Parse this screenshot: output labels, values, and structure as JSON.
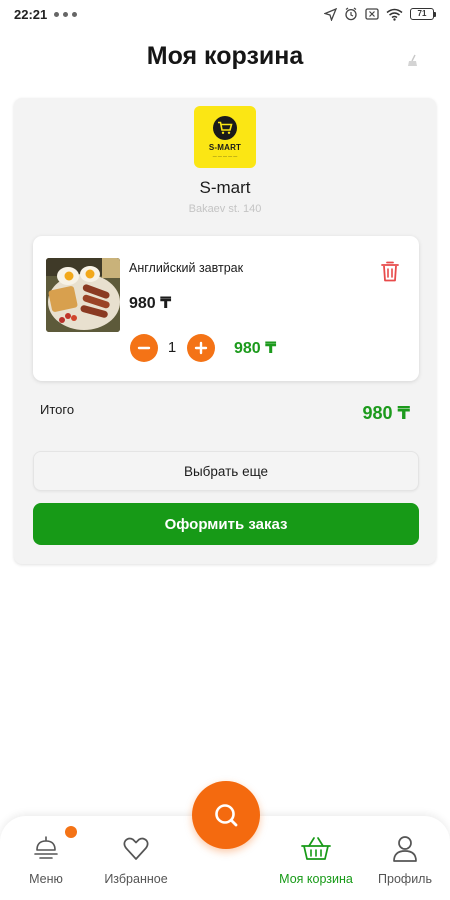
{
  "status_bar": {
    "time": "22:21",
    "battery": "71"
  },
  "header": {
    "title": "Моя корзина"
  },
  "store": {
    "name": "S-mart",
    "address": "Bakaev st. 140",
    "logo_text": "S-MART"
  },
  "cart_item": {
    "name": "Английский завтрак",
    "price": "980 ₸",
    "quantity": "1",
    "line_total": "980 ₸"
  },
  "summary": {
    "total_label": "Итого",
    "total_value": "980 ₸"
  },
  "actions": {
    "choose_more": "Выбрать еще",
    "checkout": "Оформить заказ"
  },
  "bottom_nav": {
    "items": [
      {
        "label": "Меню",
        "icon": "menu-icon",
        "active": false
      },
      {
        "label": "Избранное",
        "icon": "heart-icon",
        "active": false
      },
      {
        "label": "Моя корзина",
        "icon": "basket-icon",
        "active": true
      },
      {
        "label": "Профиль",
        "icon": "profile-icon",
        "active": false
      }
    ],
    "fab_icon": "search-icon"
  },
  "colors": {
    "accent_orange": "#f46a0f",
    "accent_green": "#179a17",
    "logo_yellow": "#fbe614",
    "trash_red": "#e84a4a"
  }
}
